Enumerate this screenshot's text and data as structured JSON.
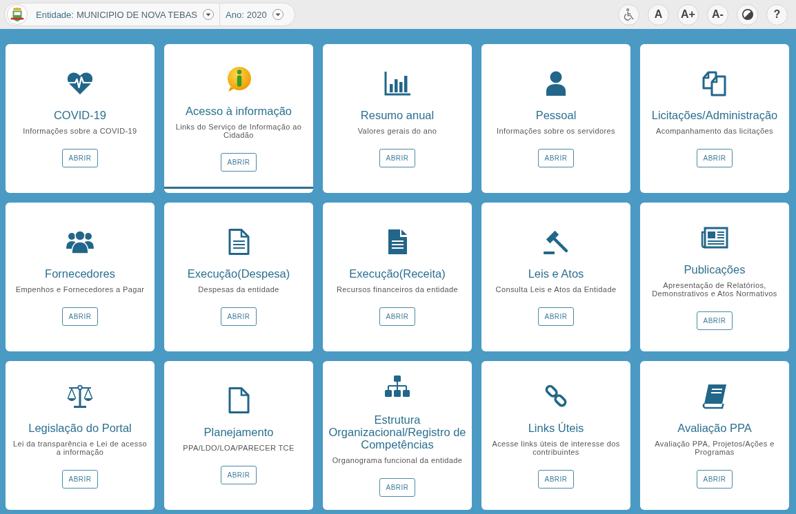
{
  "header": {
    "entity": {
      "label": "Entidade:",
      "value": "MUNICIPIO DE NOVA TEBAS"
    },
    "year": {
      "label": "Ano:",
      "value": "2020"
    },
    "tools": [
      {
        "kind": "icon"
      },
      {
        "kind": "text",
        "label": "A"
      },
      {
        "kind": "text",
        "label": "A+"
      },
      {
        "kind": "text",
        "label": "A-"
      },
      {
        "kind": "icon"
      },
      {
        "kind": "text",
        "label": "?"
      }
    ]
  },
  "cards": [
    {
      "title": "COVID-19",
      "description": "Informações sobre a COVID-19",
      "button": "ABRIR",
      "selected": false
    },
    {
      "title": "Acesso à informação",
      "description": "Links do Serviço de Informação ao Cidadão",
      "button": "ABRIR",
      "selected": true
    },
    {
      "title": "Resumo anual",
      "description": "Valores gerais do ano",
      "button": "ABRIR",
      "selected": false
    },
    {
      "title": "Pessoal",
      "description": "Informações sobre os servidores",
      "button": "ABRIR",
      "selected": false
    },
    {
      "title": "Licitações/Administração",
      "description": "Acompanhamento das licitações",
      "button": "ABRIR",
      "selected": false
    },
    {
      "title": "Fornecedores",
      "description": "Empenhos e Fornecedores a Pagar",
      "button": "ABRIR",
      "selected": false
    },
    {
      "title": "Execução(Despesa)",
      "description": "Despesas da entidade",
      "button": "ABRIR",
      "selected": false
    },
    {
      "title": "Execução(Receita)",
      "description": "Recursos financeiros da entidade",
      "button": "ABRIR",
      "selected": false
    },
    {
      "title": "Leis e Atos",
      "description": "Consulta Leis e Atos da Entidade",
      "button": "ABRIR",
      "selected": false
    },
    {
      "title": "Publicações",
      "description": "Apresentação de Relatórios, Demonstrativos e Atos Normativos",
      "button": "ABRIR",
      "selected": false
    },
    {
      "title": "Legislação do Portal",
      "description": "Lei da transparência e Lei de acesso a informação",
      "button": "ABRIR",
      "selected": false
    },
    {
      "title": "Planejamento",
      "description": "PPA/LDO/LOA/PARECER TCE",
      "button": "ABRIR",
      "selected": false
    },
    {
      "title": "Estrutura Organizacional/Registro de Competências",
      "description": "Organograma funcional da entidade",
      "button": "ABRIR",
      "selected": false
    },
    {
      "title": "Links Úteis",
      "description": "Acesse links úteis de interesse dos contribuintes",
      "button": "ABRIR",
      "selected": false
    },
    {
      "title": "Avaliação PPA",
      "description": "Avaliação PPA, Projetos/Ações e Programas",
      "button": "ABRIR",
      "selected": false
    }
  ]
}
